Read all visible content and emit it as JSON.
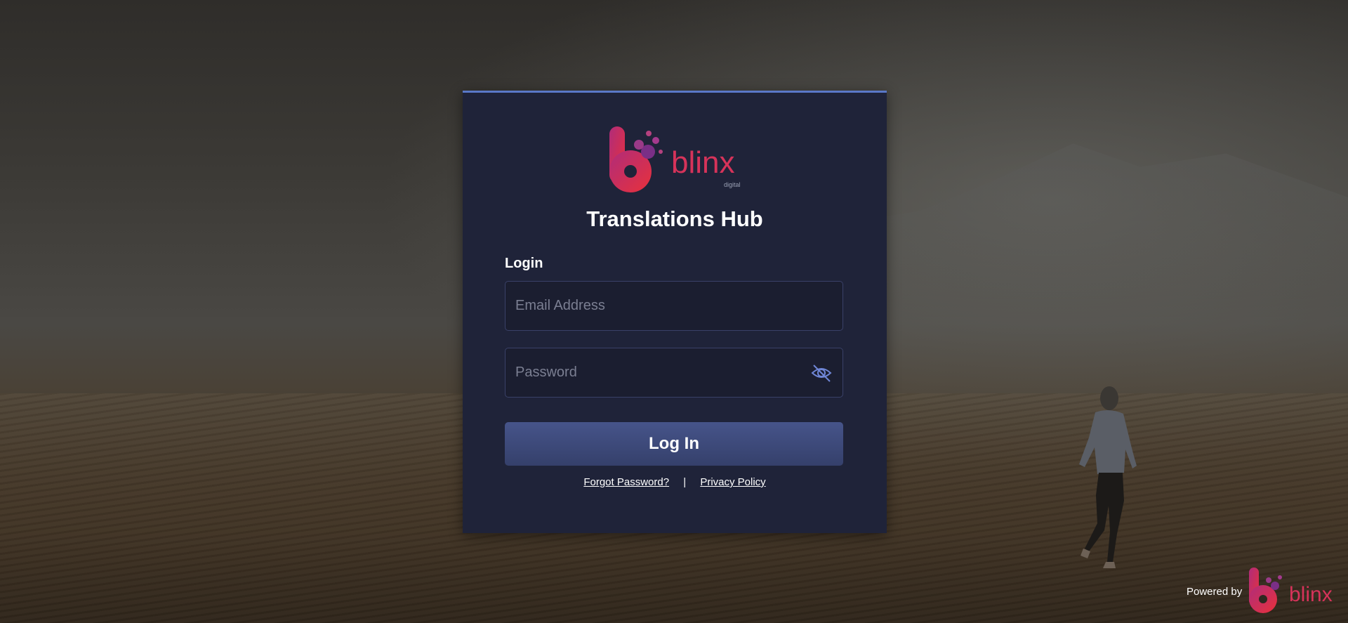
{
  "brand": {
    "logo_text": "blinx",
    "logo_subtext": "digital"
  },
  "app_title": "Translations Hub",
  "login_form": {
    "heading": "Login",
    "email": {
      "placeholder": "Email Address",
      "value": ""
    },
    "password": {
      "placeholder": "Password",
      "value": ""
    },
    "password_toggle_icon": "eye-slash-icon",
    "submit_label": "Log In"
  },
  "links": {
    "forgot_password": "Forgot Password?",
    "separator": "|",
    "privacy_policy": "Privacy Policy"
  },
  "footer": {
    "powered_by_label": "Powered by",
    "powered_logo_text": "blinx"
  },
  "colors": {
    "card_background": "#1f2339",
    "accent_border": "#5a78c8",
    "button_background": "#3d4a7a",
    "logo_red": "#e0283c",
    "logo_purple": "#8a2f8c"
  }
}
